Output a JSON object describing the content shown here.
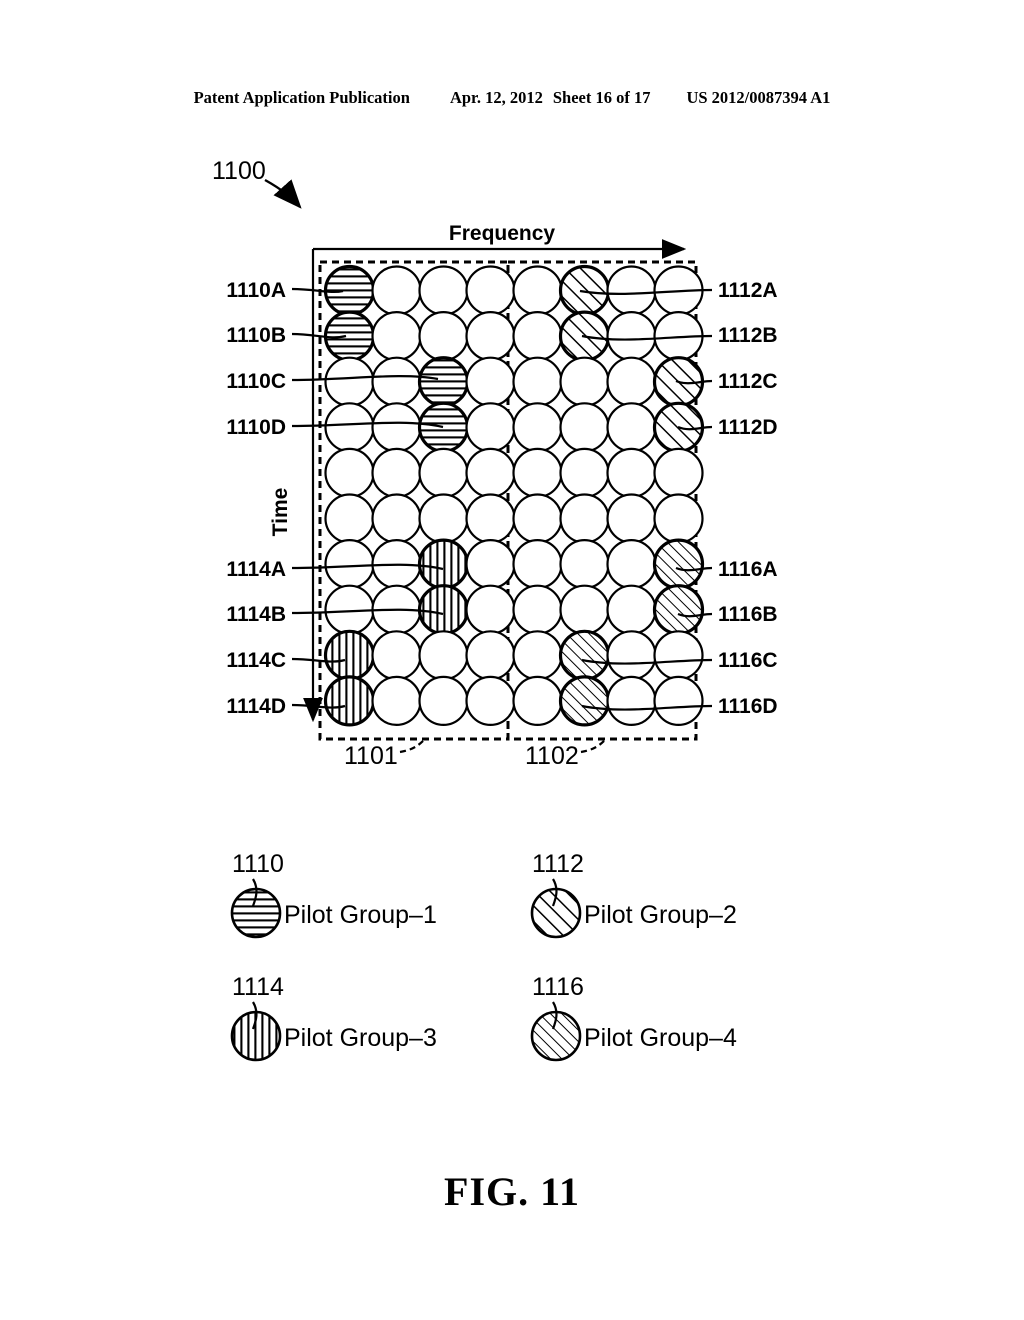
{
  "header": {
    "publication": "Patent Application Publication",
    "date": "Apr. 12, 2012",
    "sheet": "Sheet 16 of 17",
    "docnum": "US 2012/0087394 A1"
  },
  "figure": {
    "caption": "FIG. 11",
    "diagram_ref": "1100",
    "axis_x_label": "Frequency",
    "axis_y_label": "Time"
  },
  "block_labels": {
    "left_block": "1101",
    "right_block": "1102"
  },
  "callouts_left_top": [
    "1110A",
    "1110B",
    "1110C",
    "1110D"
  ],
  "callouts_right_top": [
    "1112A",
    "1112B",
    "1112C",
    "1112D"
  ],
  "callouts_left_bottom": [
    "1114A",
    "1114B",
    "1114C",
    "1114D"
  ],
  "callouts_right_bottom": [
    "1116A",
    "1116B",
    "1116C",
    "1116D"
  ],
  "legend": [
    {
      "ref": "1110",
      "label": "Pilot Group–1",
      "pattern": "horizontal-lines"
    },
    {
      "ref": "1112",
      "label": "Pilot Group–2",
      "pattern": "diagonal-hatch-coarse"
    },
    {
      "ref": "1114",
      "label": "Pilot Group–3",
      "pattern": "vertical-lines"
    },
    {
      "ref": "1116",
      "label": "Pilot Group–4",
      "pattern": "diagonal-hatch-fine"
    }
  ],
  "chart_data": {
    "type": "heatmap",
    "title": "OFDM pilot pattern resource grid 1100",
    "xlabel": "Frequency",
    "ylabel": "Time",
    "columns": 8,
    "rows": 10,
    "sub_blocks": [
      {
        "ref": "1101",
        "columns": [
          0,
          1,
          2,
          3
        ]
      },
      {
        "ref": "1102",
        "columns": [
          4,
          5,
          6,
          7
        ]
      }
    ],
    "cells": [
      {
        "row": 0,
        "col": 0,
        "group": "1110A",
        "pattern": "horizontal-lines"
      },
      {
        "row": 1,
        "col": 0,
        "group": "1110B",
        "pattern": "horizontal-lines"
      },
      {
        "row": 2,
        "col": 2,
        "group": "1110C",
        "pattern": "horizontal-lines"
      },
      {
        "row": 3,
        "col": 2,
        "group": "1110D",
        "pattern": "horizontal-lines"
      },
      {
        "row": 0,
        "col": 5,
        "group": "1112A",
        "pattern": "diagonal-hatch-coarse"
      },
      {
        "row": 1,
        "col": 5,
        "group": "1112B",
        "pattern": "diagonal-hatch-coarse"
      },
      {
        "row": 2,
        "col": 7,
        "group": "1112C",
        "pattern": "diagonal-hatch-coarse"
      },
      {
        "row": 3,
        "col": 7,
        "group": "1112D",
        "pattern": "diagonal-hatch-coarse"
      },
      {
        "row": 6,
        "col": 2,
        "group": "1114A",
        "pattern": "vertical-lines"
      },
      {
        "row": 7,
        "col": 2,
        "group": "1114B",
        "pattern": "vertical-lines"
      },
      {
        "row": 8,
        "col": 0,
        "group": "1114C",
        "pattern": "vertical-lines"
      },
      {
        "row": 9,
        "col": 0,
        "group": "1114D",
        "pattern": "vertical-lines"
      },
      {
        "row": 6,
        "col": 7,
        "group": "1116A",
        "pattern": "diagonal-hatch-fine"
      },
      {
        "row": 7,
        "col": 7,
        "group": "1116B",
        "pattern": "diagonal-hatch-fine"
      },
      {
        "row": 8,
        "col": 5,
        "group": "1116C",
        "pattern": "diagonal-hatch-fine"
      },
      {
        "row": 9,
        "col": 5,
        "group": "1116D",
        "pattern": "diagonal-hatch-fine"
      }
    ],
    "legend_position": "below",
    "grid": false
  }
}
